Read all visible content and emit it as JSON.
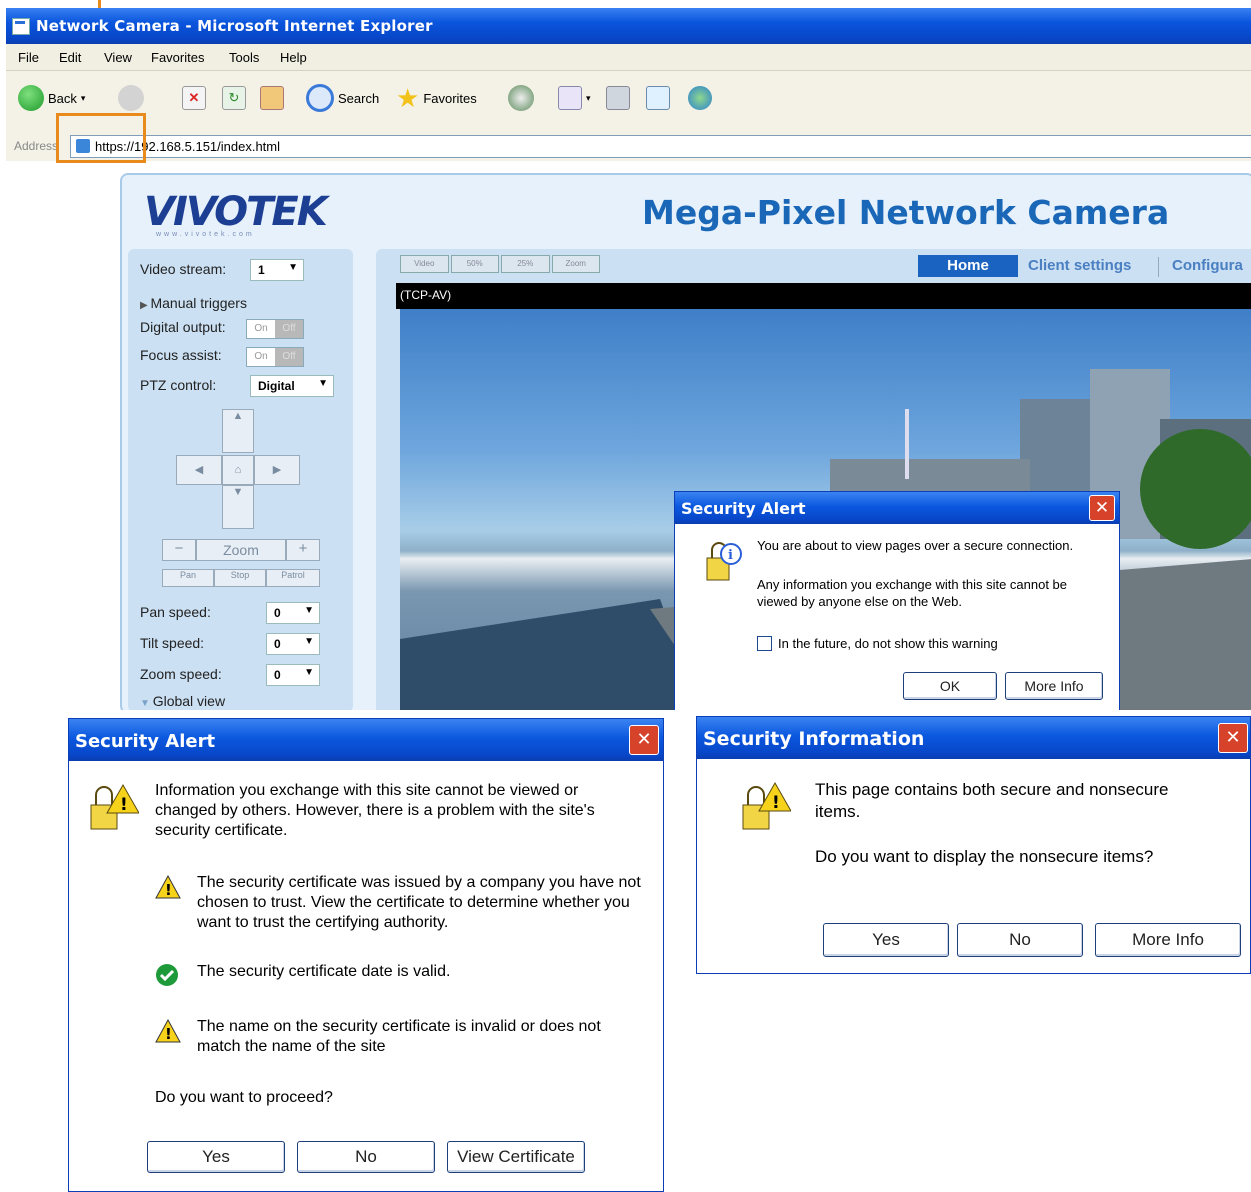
{
  "browser": {
    "title": "Network Camera - Microsoft Internet Explorer",
    "menu": [
      "File",
      "Edit",
      "View",
      "Favorites",
      "Tools",
      "Help"
    ],
    "toolbar": {
      "back": "Back",
      "search": "Search",
      "favorites": "Favorites"
    },
    "address_label": "Address",
    "url": "https://192.168.5.151/index.html"
  },
  "camera_page": {
    "logo": "VIVOTEK",
    "logo_sub": "www.vivotek.com",
    "banner": "Mega-Pixel Network Camera",
    "nav": {
      "home": "Home",
      "client": "Client settings",
      "config": "Configura"
    },
    "video_tabs": [
      "Video",
      "50%",
      "25%",
      "Zoom"
    ],
    "stream_label": "(TCP-AV)",
    "controls": {
      "video_stream_label": "Video stream:",
      "video_stream_value": "1",
      "manual_triggers": "Manual triggers",
      "digital_output": "Digital output:",
      "focus_assist": "Focus assist:",
      "on": "On",
      "off": "Off",
      "ptz_label": "PTZ control:",
      "ptz_value": "Digital",
      "zoom": "Zoom",
      "minus": "−",
      "plus": "+",
      "pan": "Pan",
      "stop": "Stop",
      "patrol": "Patrol",
      "pan_speed_label": "Pan speed:",
      "pan_speed": "0",
      "tilt_speed_label": "Tilt speed:",
      "tilt_speed": "0",
      "zoom_speed_label": "Zoom speed:",
      "zoom_speed": "0",
      "global_view": "Global view"
    }
  },
  "alert_small": {
    "title": "Security Alert",
    "line1": "You are about to view pages over a secure connection.",
    "line2": "Any information you exchange with this site cannot be viewed by anyone else on the Web.",
    "checkbox": "In the future, do not show this warning",
    "ok": "OK",
    "more": "More Info"
  },
  "alert_cert": {
    "title": "Security Alert",
    "intro": "Information you exchange with this site cannot be viewed or changed by others. However, there is a problem with the site's security certificate.",
    "item1": "The security certificate was issued by a company you have not chosen to trust. View the certificate to determine whether you want to trust the certifying authority.",
    "item2": "The security certificate date is valid.",
    "item3": "The name on the security certificate is invalid or does not match the name of the site",
    "question": "Do you want to proceed?",
    "yes": "Yes",
    "no": "No",
    "view": "View Certificate"
  },
  "security_info": {
    "title": "Security Information",
    "line1": "This page contains both secure and nonsecure items.",
    "line2": "Do you want to display the nonsecure items?",
    "yes": "Yes",
    "no": "No",
    "more": "More Info"
  },
  "colors": {
    "title_blue": "#0b58df",
    "callout": "#e98b1c",
    "close_red": "#d6422a",
    "warning_yellow": "#f6d21b",
    "ok_green": "#1f9a3a"
  }
}
